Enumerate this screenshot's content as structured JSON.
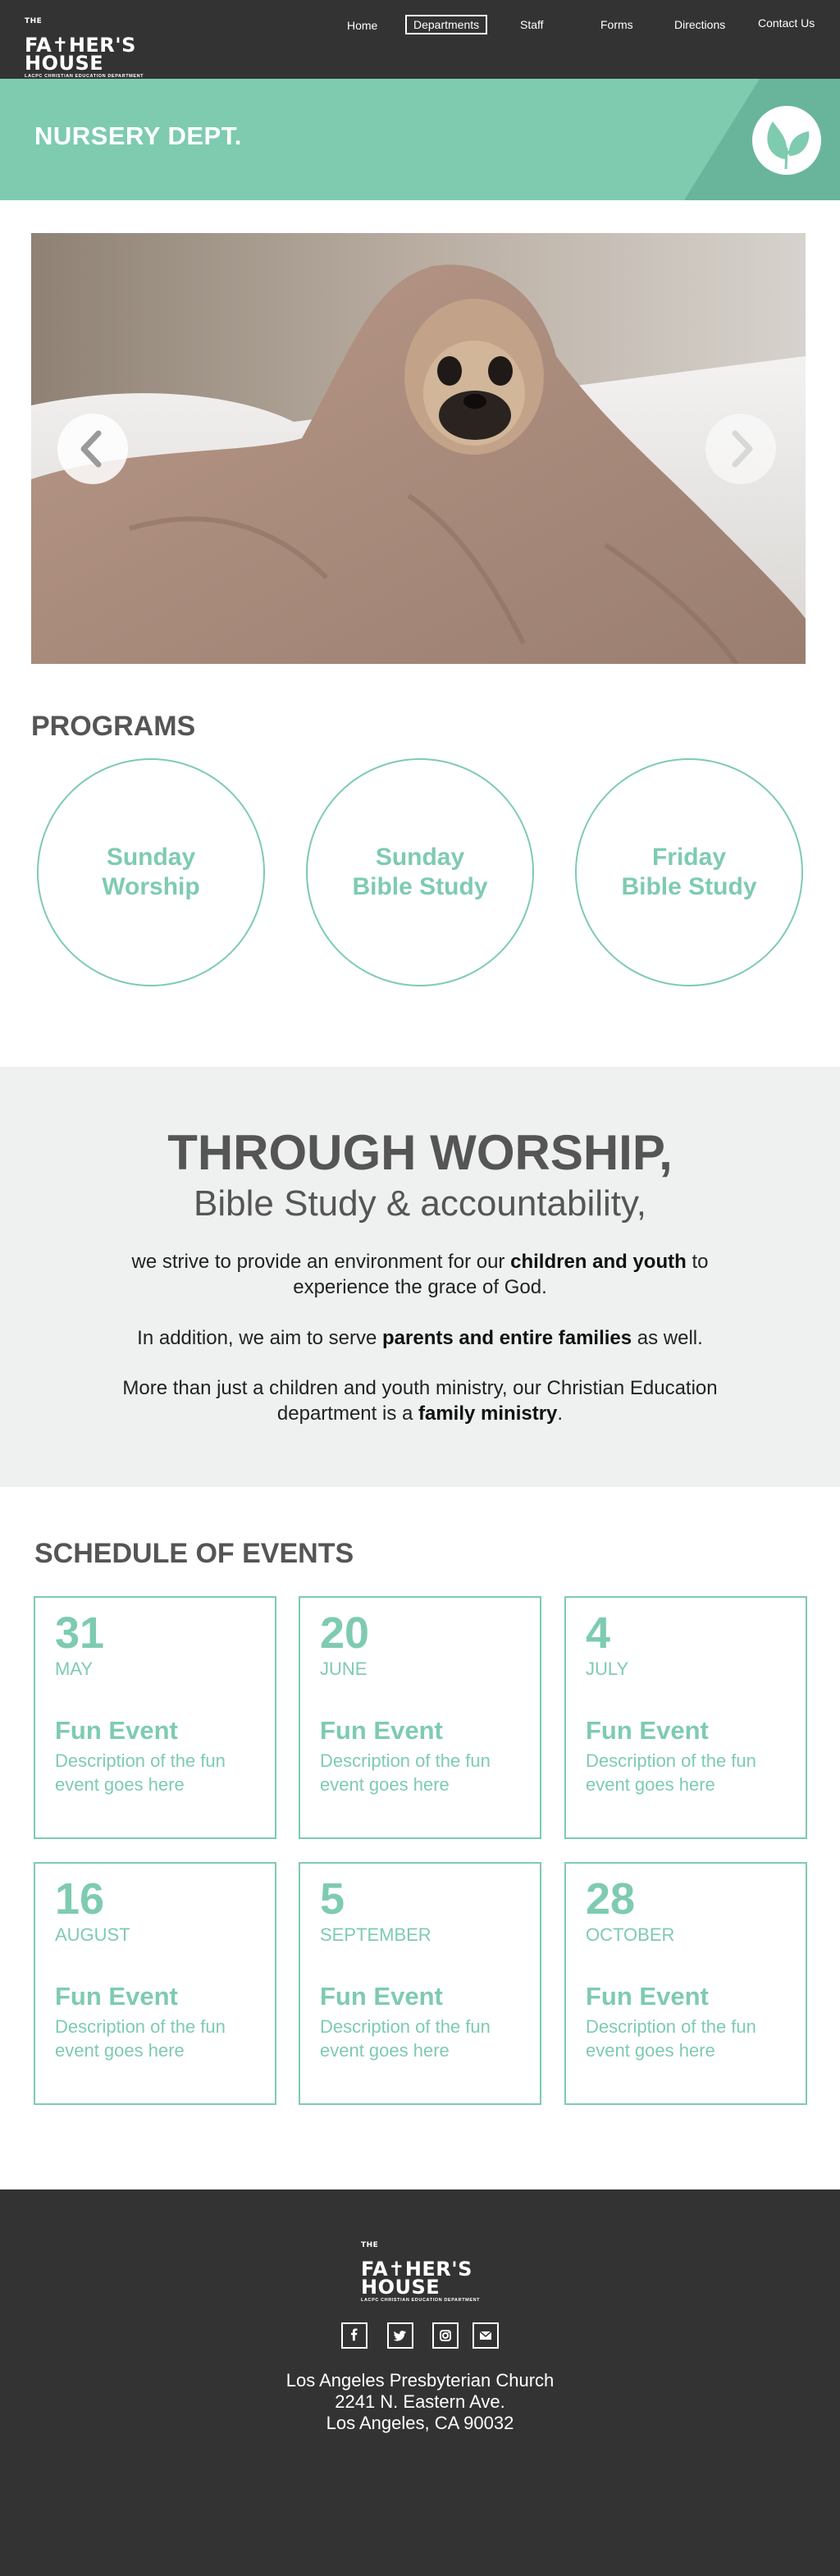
{
  "nav": {
    "logo": {
      "the": "THE",
      "name_top": "FA✝HER'S",
      "name_bottom": "HOUSE",
      "subtitle": "LACPC CHRISTIAN EDUCATION DEPARTMENT"
    },
    "links": [
      "Home",
      "Departments",
      "Staff",
      "Forms",
      "Directions",
      "Contact Us"
    ],
    "active_link": "Departments"
  },
  "banner": {
    "title": "NURSERY DEPT.",
    "icon": "leaf-icon",
    "color": "#7ecbb0"
  },
  "slider": {
    "image": "pug-in-blanket-photo",
    "prev_icon": "chevron-left-icon",
    "next_icon": "chevron-right-icon"
  },
  "programs": {
    "heading": "PROGRAMS",
    "items": [
      {
        "label": "Sunday\nWorship"
      },
      {
        "label": "Sunday\nBible Study"
      },
      {
        "label": "Friday\nBible Study"
      }
    ]
  },
  "mission": {
    "title": "THROUGH WORSHIP,",
    "subtitle": "Bible Study & accountability,",
    "p1_a": "we strive to provide an environment for our ",
    "p1_b": "children and youth",
    "p1_c": " to experience the grace of God.",
    "p2_a": "In addition, we aim to serve ",
    "p2_b": "parents and entire families",
    "p2_c": " as well.",
    "p3_a": "More than just a children and youth ministry, our Christian Education department is a ",
    "p3_b": "family ministry",
    "p3_c": "."
  },
  "schedule": {
    "heading": "SCHEDULE OF EVENTS",
    "events": [
      {
        "day": "31",
        "month": "MAY",
        "title": "Fun Event",
        "description": "Description of the fun event goes here"
      },
      {
        "day": "20",
        "month": "JUNE",
        "title": "Fun Event",
        "description": "Description of the fun event goes here"
      },
      {
        "day": "4",
        "month": "JULY",
        "title": "Fun Event",
        "description": "Description of the fun event goes here"
      },
      {
        "day": "16",
        "month": "AUGUST",
        "title": "Fun Event",
        "description": "Description of the fun event goes here"
      },
      {
        "day": "5",
        "month": "SEPTEMBER",
        "title": "Fun Event",
        "description": "Description of the fun event goes here"
      },
      {
        "day": "28",
        "month": "OCTOBER",
        "title": "Fun Event",
        "description": "Description of the fun event goes here"
      }
    ]
  },
  "footer": {
    "logo": {
      "the": "THE",
      "name_top": "FA✝HER'S",
      "name_bottom": "HOUSE",
      "subtitle": "LACPC CHRISTIAN EDUCATION DEPARTMENT"
    },
    "social_icons": [
      "facebook-icon",
      "twitter-icon",
      "instagram-icon",
      "email-icon"
    ],
    "address": [
      "Los Angeles Presbyterian Church",
      "2241 N. Eastern Ave.",
      "Los Angeles, CA 90032"
    ]
  },
  "colors": {
    "accent": "#7ecbb0",
    "dark": "#333333",
    "heading": "#555555",
    "light_bg": "#eff0f0"
  }
}
